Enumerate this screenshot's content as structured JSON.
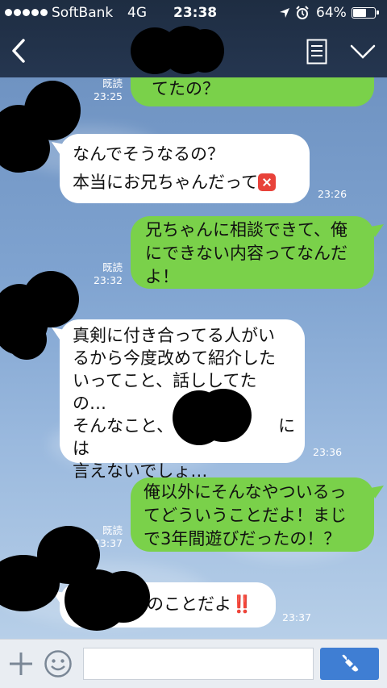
{
  "status_bar": {
    "carrier": "SoftBank",
    "network": "4G",
    "time": "23:38",
    "battery_text": "64%",
    "battery_level": 0.64,
    "icons": [
      "signal-dots-icon",
      "location-arrow-icon",
      "alarm-clock-icon",
      "battery-icon"
    ]
  },
  "nav": {
    "back_icon": "chevron-left-icon",
    "contact_name_hidden": true,
    "menu_icon": "document-lines-icon",
    "more_icon": "chevron-down-icon"
  },
  "messages": [
    {
      "side": "right",
      "lines": [
        "てたの？"
      ],
      "read": "既読",
      "time": "23:25"
    },
    {
      "side": "left",
      "lines": [
        "なんでそうなるの？",
        "本当にお兄ちゃんだって"
      ],
      "emoji": "anger-icon",
      "time": "23:26"
    },
    {
      "side": "right",
      "lines": [
        "兄ちゃんに相談できて、俺",
        "にできない内容ってなんだ",
        "よ！"
      ],
      "read": "既読",
      "time": "23:32"
    },
    {
      "side": "left",
      "lines": [
        "真剣に付き合ってる人がい",
        "るから今度改めて紹介した",
        "いってこと、話ししてた",
        "の…",
        "そんなこと、",
        "言えないでしょ…"
      ],
      "line5_suffix": "には",
      "time": "23:36"
    },
    {
      "side": "right",
      "lines": [
        "俺以外にそんなやついるっ",
        "てどういうことだよ！まじ",
        "で3年間遊びだったの！？"
      ],
      "read": "既読",
      "time": "23:37"
    },
    {
      "side": "left",
      "lines": [
        "のことだよ"
      ],
      "emoji": "double-exclamation-icon",
      "emoji_text": "‼️",
      "time": "23:37"
    }
  ],
  "composer": {
    "add_icon": "plus-icon",
    "sticker_icon": "smiley-icon",
    "input_value": "",
    "call_icon": "phone-icon"
  },
  "colors": {
    "header": "#1e2d42",
    "outgoing_bubble": "#7ad14a",
    "incoming_bubble": "#ffffff",
    "call_button": "#3f7ed3"
  }
}
